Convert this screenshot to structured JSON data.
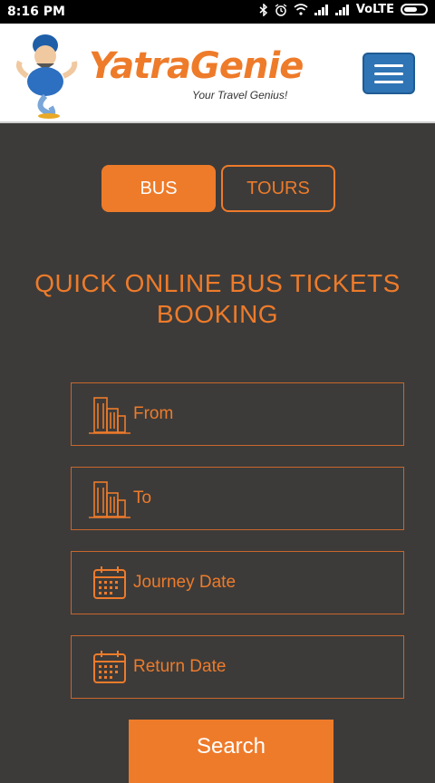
{
  "status_bar": {
    "time": "8:16 PM",
    "network_label": "VoLTE"
  },
  "header": {
    "brand": "YatraGenie",
    "tagline": "Your Travel Genius!"
  },
  "tabs": [
    {
      "label": "BUS",
      "active": true
    },
    {
      "label": "TOURS",
      "active": false
    }
  ],
  "heading": {
    "line1": "QUICK ONLINE BUS TICKETS",
    "line2": "BOOKING"
  },
  "form": {
    "from_placeholder": "From",
    "to_placeholder": "To",
    "journey_date_placeholder": "Journey Date",
    "return_date_placeholder": "Return Date",
    "search_label": "Search"
  },
  "colors": {
    "accent": "#ee7b2a",
    "background": "#3c3b3a",
    "menu_button": "#2f74b5"
  }
}
